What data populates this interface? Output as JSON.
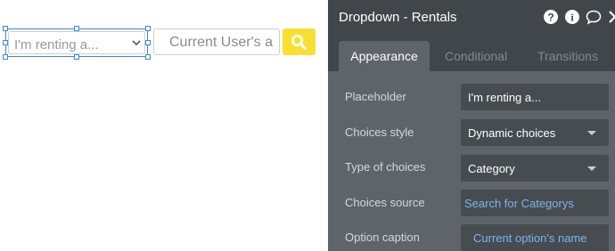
{
  "canvas": {
    "dropdown_placeholder": "I'm renting a...",
    "search_input_text": "Current User's a",
    "accent_color": "#f7e033",
    "selection_color": "#3f86d4"
  },
  "panel": {
    "title": "Dropdown - Rentals",
    "header_icons": [
      "question-icon",
      "info-icon",
      "comment-icon",
      "close-icon"
    ],
    "tabs": [
      {
        "label": "Appearance",
        "active": true
      },
      {
        "label": "Conditional",
        "active": false
      },
      {
        "label": "Transitions",
        "active": false
      }
    ],
    "rows": [
      {
        "label": "Placeholder",
        "value": "I'm renting a..."
      },
      {
        "label": "Choices style",
        "value": "Dynamic choices"
      },
      {
        "label": "Type of choices",
        "value": "Category"
      },
      {
        "label": "Choices source",
        "value": "Search for Categorys"
      },
      {
        "label": "Option caption",
        "value": "Current option's name"
      }
    ]
  }
}
